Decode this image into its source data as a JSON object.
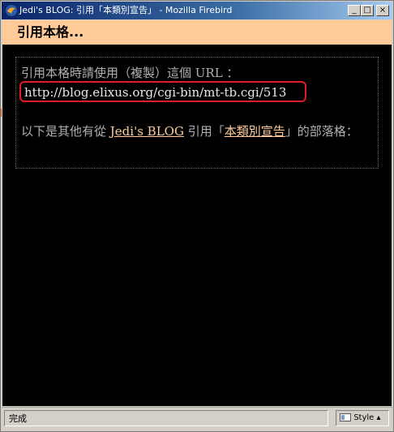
{
  "window": {
    "title": "Jedi's BLOG: 引用「本類別宣告」 - Mozilla Firebird",
    "buttons": {
      "minimize": "_",
      "maximize": "□",
      "close": "×"
    }
  },
  "header": {
    "title": "引用本格..."
  },
  "main": {
    "intro": "引用本格時請使用（複製）這個 URL ：",
    "trackback_url": "http://blog.elixus.org/cgi-bin/mt-tb.cgi/513",
    "para_prefix": "以下是其他有從",
    "blog_link": "Jedi's BLOG",
    "para_middle": "引用「",
    "category_link": "本類別宣告",
    "para_suffix": "」的部落格："
  },
  "statusbar": {
    "text": "完成",
    "style_label": "Style"
  }
}
